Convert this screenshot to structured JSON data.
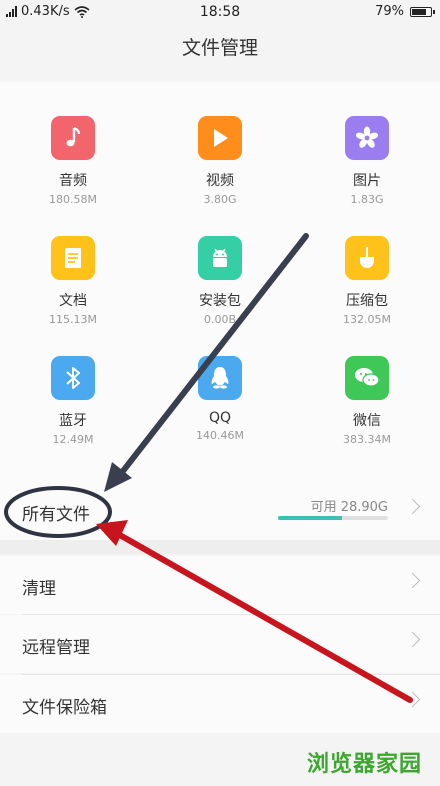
{
  "status": {
    "speed": "0.43K/s",
    "time": "18:58",
    "battery": "79%",
    "battery_level": 0.79
  },
  "header": {
    "title": "文件管理"
  },
  "categories": [
    {
      "name": "音频",
      "size": "180.58M",
      "icon": "music-note-icon",
      "color": "#f2656d"
    },
    {
      "name": "视频",
      "size": "3.80G",
      "icon": "play-icon",
      "color": "#ff8d1b"
    },
    {
      "name": "图片",
      "size": "1.83G",
      "icon": "flower-icon",
      "color": "#9a7ef0"
    },
    {
      "name": "文档",
      "size": "115.13M",
      "icon": "document-icon",
      "color": "#ffc21a"
    },
    {
      "name": "安装包",
      "size": "0.00B",
      "icon": "android-icon",
      "color": "#35cfa6"
    },
    {
      "name": "压缩包",
      "size": "132.05M",
      "icon": "archive-icon",
      "color": "#ffc21a"
    },
    {
      "name": "蓝牙",
      "size": "12.49M",
      "icon": "bluetooth-icon",
      "color": "#4aa9ef"
    },
    {
      "name": "QQ",
      "size": "140.46M",
      "icon": "qq-penguin-icon",
      "color": "#4aa9ef"
    },
    {
      "name": "微信",
      "size": "383.34M",
      "icon": "wechat-icon",
      "color": "#3fc758"
    }
  ],
  "all_files": {
    "label": "所有文件",
    "available": "可用 28.90G",
    "usage_fraction": 0.58
  },
  "menu": [
    {
      "label": "清理"
    },
    {
      "label": "远程管理"
    },
    {
      "label": "文件保险箱"
    }
  ],
  "watermark": "浏览器家园"
}
